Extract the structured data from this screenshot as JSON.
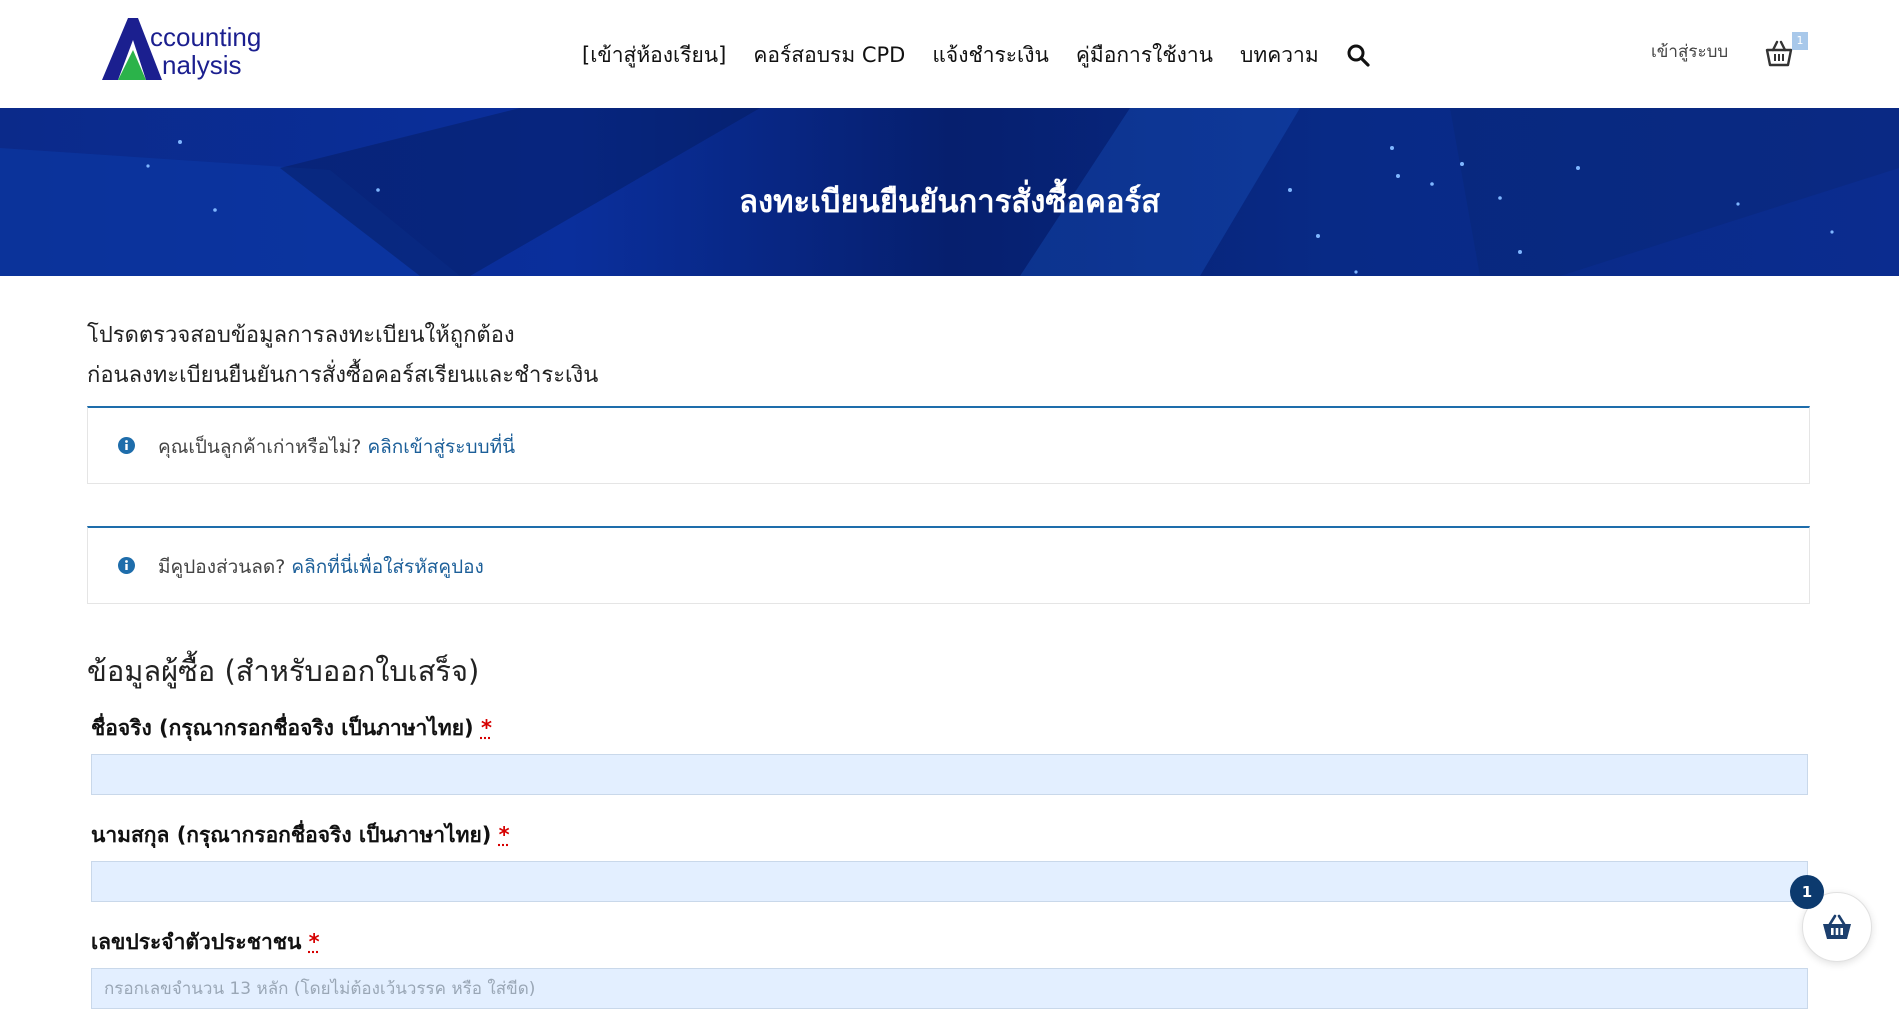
{
  "logo": {
    "line1": "ccounting",
    "line2": "nalysis"
  },
  "nav": {
    "items": [
      "[เข้าสู่ห้องเรียน]",
      "คอร์สอบรม CPD",
      "แจ้งชำระเงิน",
      "คู่มือการใช้งาน",
      "บทความ"
    ],
    "login": "เข้าสู่ระบบ",
    "cart_count": "1"
  },
  "banner": {
    "title": "ลงทะเบียนยืนยันการสั่งซื้อคอร์ส"
  },
  "intro": {
    "line1": "โปรดตรวจสอบข้อมูลการลงทะเบียนให้ถูกต้อง",
    "line2": "ก่อนลงทะเบียนยืนยันการสั่งซื้อคอร์สเรียนและชำระเงิน"
  },
  "notices": {
    "returning": {
      "text": "คุณเป็นลูกค้าเก่าหรือไม่?",
      "link": "คลิกเข้าสู่ระบบที่นี่"
    },
    "coupon": {
      "text": "มีคูปองส่วนลด?",
      "link": "คลิกที่นี่เพื่อใส่รหัสคูปอง"
    }
  },
  "billing": {
    "title": "ข้อมูลผู้ซื้อ (สำหรับออกใบเสร็จ)",
    "first_name_label": "ชื่อจริง (กรุณากรอกชื่อจริง เป็นภาษาไทย)",
    "last_name_label": "นามสกุล (กรุณากรอกชื่อจริง เป็นภาษาไทย)",
    "id_label": "เลขประจำตัวประชาชน",
    "id_placeholder": "กรอกเลขจำนวน 13 หลัก (โดยไม่ต้องเว้นวรรค หรือ ใส่ขีด)",
    "required_mark": "*"
  },
  "floating_cart": {
    "count": "1"
  },
  "colors": {
    "accent": "#1e6dab",
    "banner": "#0b2a8a",
    "input_bg": "#e3efff",
    "badge": "#0c3a6e"
  }
}
